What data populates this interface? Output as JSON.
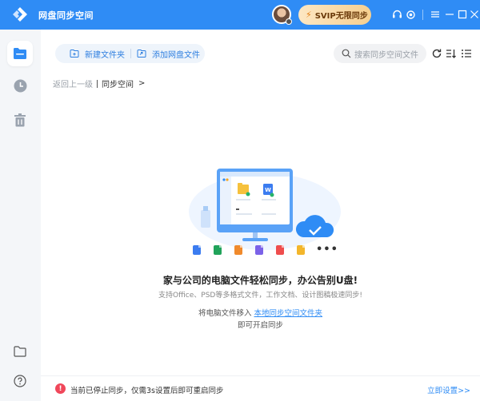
{
  "titlebar": {
    "app_title": "网盘同步空间",
    "svip_label": "SVIP无限同步",
    "icons": [
      "support-icon",
      "settings-icon",
      "menu-icon",
      "minimize-icon",
      "maximize-icon",
      "close-icon"
    ],
    "color": "#2f8cf5"
  },
  "sidebar": {
    "items": [
      "sync-folder-icon",
      "history-icon",
      "trash-icon"
    ],
    "bottom_items": [
      "open-folder-icon",
      "help-icon"
    ]
  },
  "toolbar": {
    "new_folder_label": "新建文件夹",
    "add_cloud_file_label": "添加网盘文件",
    "search_placeholder": "搜索同步空间文件"
  },
  "breadcrumb": {
    "back_label": "返回上一级",
    "current_label": "同步空间",
    "arrow": ">"
  },
  "empty_state": {
    "headline": "家与公司的电脑文件轻松同步，办公告别U盘!",
    "subline": "支持Office、PSD等多格式文件，工作文档、设计图稿极速同步!",
    "move_prefix": "将电脑文件移入 ",
    "move_link": "本地同步空间文件夹",
    "start_label": "即可开启同步",
    "file_types": [
      {
        "name": "word-file-icon",
        "color": "#3b7cf0"
      },
      {
        "name": "excel-file-icon",
        "color": "#21a35a"
      },
      {
        "name": "ppt-file-icon",
        "color": "#f08a2c"
      },
      {
        "name": "video-file-icon",
        "color": "#7b62e8"
      },
      {
        "name": "pdf-file-icon",
        "color": "#ef4d4d"
      },
      {
        "name": "image-file-icon",
        "color": "#f3b62b"
      }
    ],
    "more_label": "•••"
  },
  "status": {
    "message": "当前已停止同步，仅需3s设置后即可重启同步",
    "action_label": "立即设置>>",
    "warn_glyph": "!"
  }
}
